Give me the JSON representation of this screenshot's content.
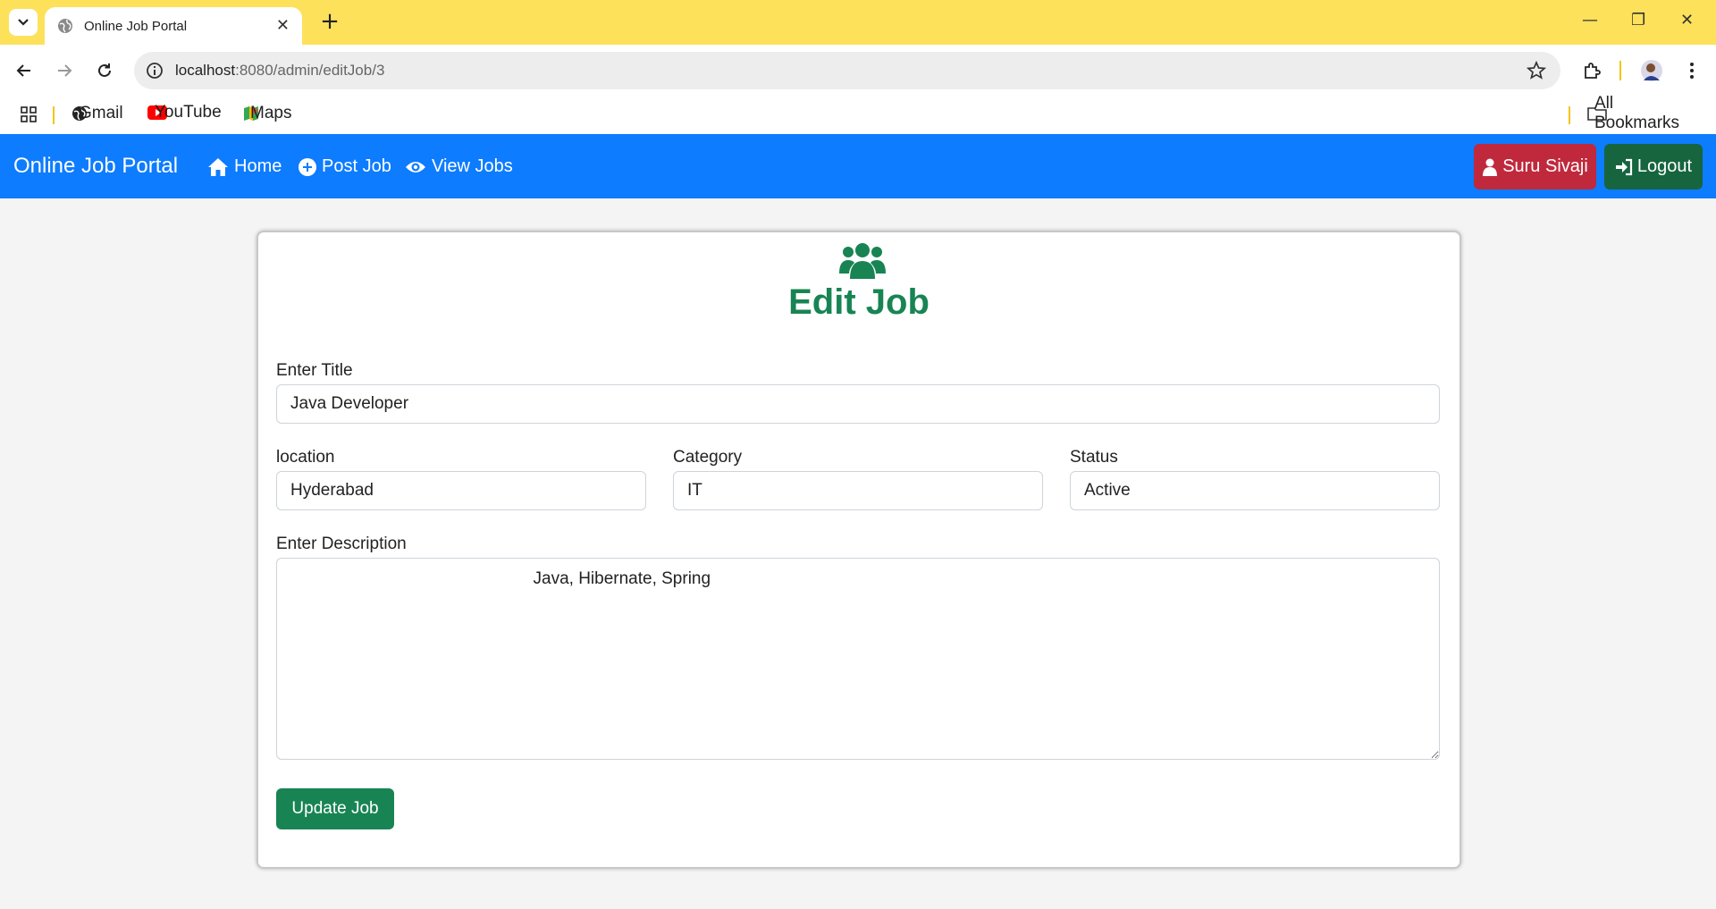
{
  "browser": {
    "tab_title": "Online Job Portal",
    "url_host": "localhost",
    "url_path": ":8080/admin/editJob/3",
    "bookmarks": [
      {
        "label": "Gmail",
        "icon": "globe-icon"
      },
      {
        "label": "YouTube",
        "icon": "youtube-icon"
      },
      {
        "label": "Maps",
        "icon": "maps-icon"
      }
    ],
    "all_bookmarks": "All Bookmarks"
  },
  "navbar": {
    "brand": "Online Job Portal",
    "links": [
      {
        "label": "Home",
        "icon": "home-icon"
      },
      {
        "label": "Post Job",
        "icon": "plus-circle-icon"
      },
      {
        "label": "View Jobs",
        "icon": "eye-icon"
      }
    ],
    "user_label": "Suru Sivaji",
    "logout_label": "Logout",
    "colors": {
      "bar": "#0d7cff",
      "user": "#c0293c",
      "logout": "#16653f"
    }
  },
  "form": {
    "title": "Edit Job",
    "title_icon": "users-icon",
    "title_label": "Enter Title",
    "title_value": "Java Developer",
    "location_label": "location",
    "location_value": "Hyderabad",
    "category_label": "Category",
    "category_value": "IT",
    "status_label": "Status",
    "status_value": "Active",
    "description_label": "Enter Description",
    "description_value": "                                                    Java, Hibernate, Spring",
    "submit_label": "Update Job",
    "accent": "#188453"
  }
}
